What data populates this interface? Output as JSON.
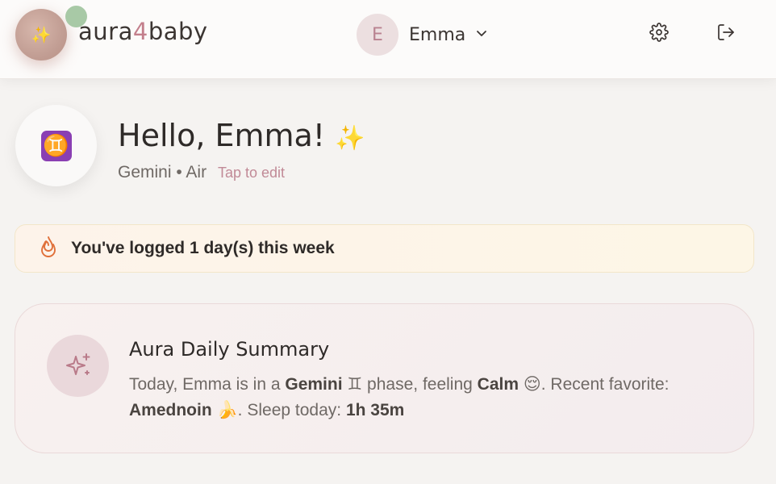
{
  "header": {
    "logo": {
      "part1": "aura",
      "part2": "4",
      "part3": "baby",
      "orb_emoji": "✨"
    },
    "profile": {
      "initial": "E",
      "name": "Emma"
    },
    "icons": {
      "settings": "gear-icon",
      "logout": "logout-icon",
      "chevron": "chevron-down-icon"
    }
  },
  "hero": {
    "sign_symbol": "♊",
    "greeting": "Hello, Emma!",
    "greeting_emoji": "✨",
    "sign": "Gemini",
    "separator": "•",
    "element": "Air",
    "edit_label": "Tap to edit"
  },
  "streak": {
    "text": "You've logged 1 day(s) this week",
    "icon": "flame-icon"
  },
  "summary": {
    "title": "Aura Daily Summary",
    "icon": "sparkles-icon",
    "t1": "Today, Emma is in a ",
    "phase": "Gemini",
    "phase_emoji": "♊",
    "t2": " phase, feeling ",
    "mood": "Calm",
    "mood_emoji": "😌",
    "t3": ". Recent favorite: ",
    "favorite": "Amednoin",
    "favorite_emoji": "🍌",
    "t4": ". Sleep today: ",
    "sleep": "1h 35m"
  },
  "colors": {
    "accent": "#c37f8c",
    "background": "#f5f3f1",
    "flame": "#e0703a"
  }
}
